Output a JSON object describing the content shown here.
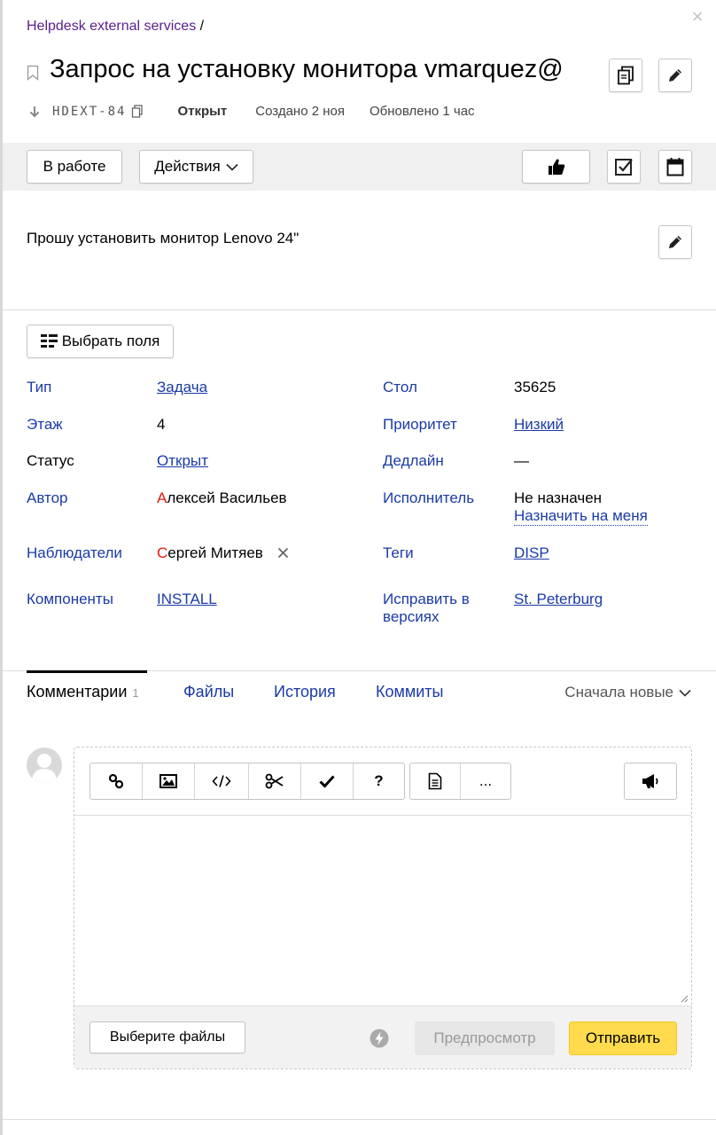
{
  "breadcrumb": {
    "queue": "Helpdesk external services",
    "separator": "/"
  },
  "issue": {
    "title": "Запрос на установку монитора vmarquez@",
    "key": "HDEXT-84",
    "status": "Открыт",
    "created": "Создано 2 ноя",
    "updated": "Обновлено 1 час"
  },
  "toolbar": {
    "in_progress_label": "В работе",
    "actions_label": "Действия"
  },
  "description": "Прошу установить монитор Lenovo 24\"",
  "fields_button": "Выбрать поля",
  "fields": {
    "type": {
      "label": "Тип",
      "value": "Задача"
    },
    "desk": {
      "label": "Стол",
      "value": "35625"
    },
    "floor": {
      "label": "Этаж",
      "value": "4"
    },
    "priority": {
      "label": "Приоритет",
      "value": "Низкий"
    },
    "status": {
      "label": "Статус",
      "value": "Открыт"
    },
    "deadline": {
      "label": "Дедлайн",
      "value": "—"
    },
    "author": {
      "label": "Автор",
      "initial": "А",
      "rest": "лексей Васильев"
    },
    "assignee": {
      "label": "Исполнитель",
      "value": "Не назначен",
      "assign_me": "Назначить на меня"
    },
    "followers": {
      "label": "Наблюдатели",
      "initial": "С",
      "rest": "ергей Митяев"
    },
    "tags": {
      "label": "Теги",
      "value": "DISP"
    },
    "components": {
      "label": "Компоненты",
      "value": "INSTALL"
    },
    "fix_versions": {
      "label_line1": "Исправить в",
      "label_line2": "версиях",
      "value": "St. Peterburg"
    }
  },
  "tabs": {
    "comments": "Комментарии",
    "comments_count": "1",
    "files": "Файлы",
    "history": "История",
    "commits": "Коммиты",
    "sort": "Сначала новые"
  },
  "editor": {
    "more_label": "...",
    "help_label": "?",
    "choose_files": "Выберите файлы",
    "preview": "Предпросмотр",
    "send": "Отправить"
  },
  "colors": {
    "link": "#1a3aa8",
    "breadcrumb": "#5b1d8f",
    "send_button": "#ffdb4d",
    "author_initial": "#e3180b"
  }
}
